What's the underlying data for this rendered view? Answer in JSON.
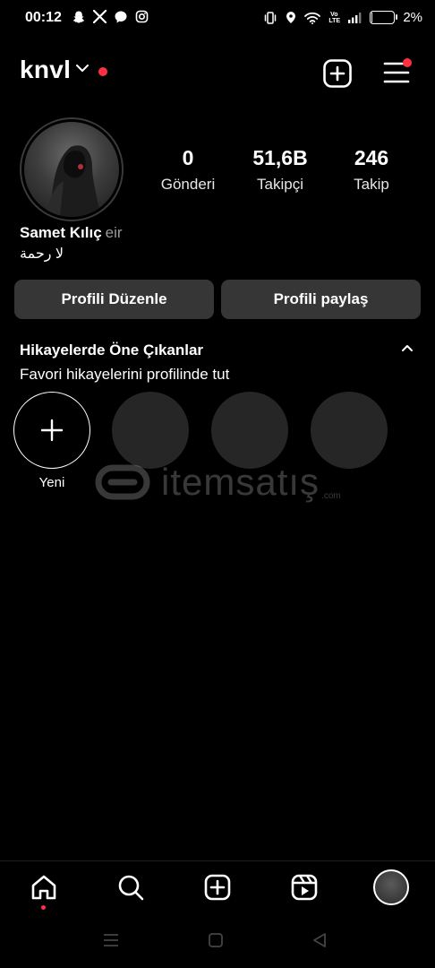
{
  "status_bar": {
    "time": "00:12",
    "left_icons": [
      "snapchat-icon",
      "x-icon",
      "messenger-icon",
      "instagram-icon"
    ],
    "right_icons": [
      "vibrate-icon",
      "location-icon",
      "wifi-icon",
      "volte-icon",
      "signal-icon"
    ],
    "volte": "Vo LTE",
    "battery": "2%",
    "battery_level": 0.02
  },
  "header": {
    "username": "knvl",
    "has_notification_dot": true,
    "accent_color": "#ff3040"
  },
  "profile": {
    "stats": [
      {
        "value": "0",
        "label": "Gönderi"
      },
      {
        "value": "51,6B",
        "label": "Takipçi"
      },
      {
        "value": "246",
        "label": "Takip"
      }
    ],
    "full_name": "Samet Kılıç",
    "pronouns": "eir",
    "bio": "لا رحمة"
  },
  "actions": {
    "edit_profile": "Profili Düzenle",
    "share_profile": "Profili paylaş"
  },
  "highlights": {
    "title": "Hikayelerde Öne Çıkanlar",
    "subtitle": "Favori hikayelerini profilinde tut",
    "new_label": "Yeni",
    "placeholder_count": 3
  },
  "watermark": {
    "text": "itemsatış",
    "domain": ".com"
  },
  "bottom_nav": {
    "items": [
      "home-icon",
      "search-icon",
      "create-icon",
      "reels-icon",
      "profile-avatar"
    ],
    "active": "home-icon"
  }
}
